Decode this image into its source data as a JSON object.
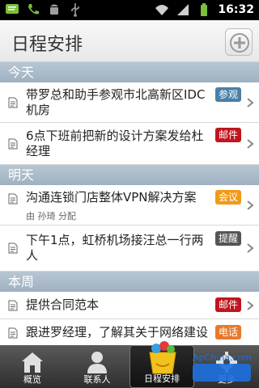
{
  "status_bar": {
    "time": "16:32",
    "left_icons": [
      "sms-icon",
      "phone-icon",
      "android-icon",
      "usb-icon"
    ],
    "right_icons": [
      "wifi-icon",
      "signal-icon",
      "battery-icon"
    ]
  },
  "header": {
    "title": "日程安排",
    "add_button_icon": "add-circle-icon"
  },
  "sections": [
    {
      "title": "今天",
      "items": [
        {
          "text": "带罗总和助手参观市北高新区IDC机房",
          "badge": "参观",
          "badge_color": "#4a7fa6"
        },
        {
          "text": "6点下班前把新的设计方案发给杜经理",
          "badge": "邮件",
          "badge_color": "#c0161d"
        }
      ]
    },
    {
      "title": "明天",
      "items": [
        {
          "text": "沟通连锁门店整体VPN解决方案",
          "sub": "由 孙琦 分配",
          "badge": "会议",
          "badge_color": "#f09a1a"
        },
        {
          "text": "下午1点，虹桥机场接汪总一行两人",
          "badge": "提醒",
          "badge_color": "#555555"
        }
      ]
    },
    {
      "title": "本周",
      "items": [
        {
          "text": "提供合同范本",
          "badge": "邮件",
          "badge_color": "#c0161d"
        },
        {
          "text": "跟进罗经理，了解其关于网络建设",
          "badge": "电话",
          "badge_color": "#e8792a"
        }
      ]
    }
  ],
  "bottom_nav": {
    "items": [
      {
        "label": "概览",
        "icon": "home-icon",
        "active": false
      },
      {
        "label": "联系人",
        "icon": "contact-icon",
        "active": false
      },
      {
        "label": "日程安排",
        "icon": "calendar-bag-icon",
        "active": true
      },
      {
        "label": "更多",
        "icon": "gear-icon",
        "active": false
      }
    ]
  },
  "watermark": "ApChina.com"
}
